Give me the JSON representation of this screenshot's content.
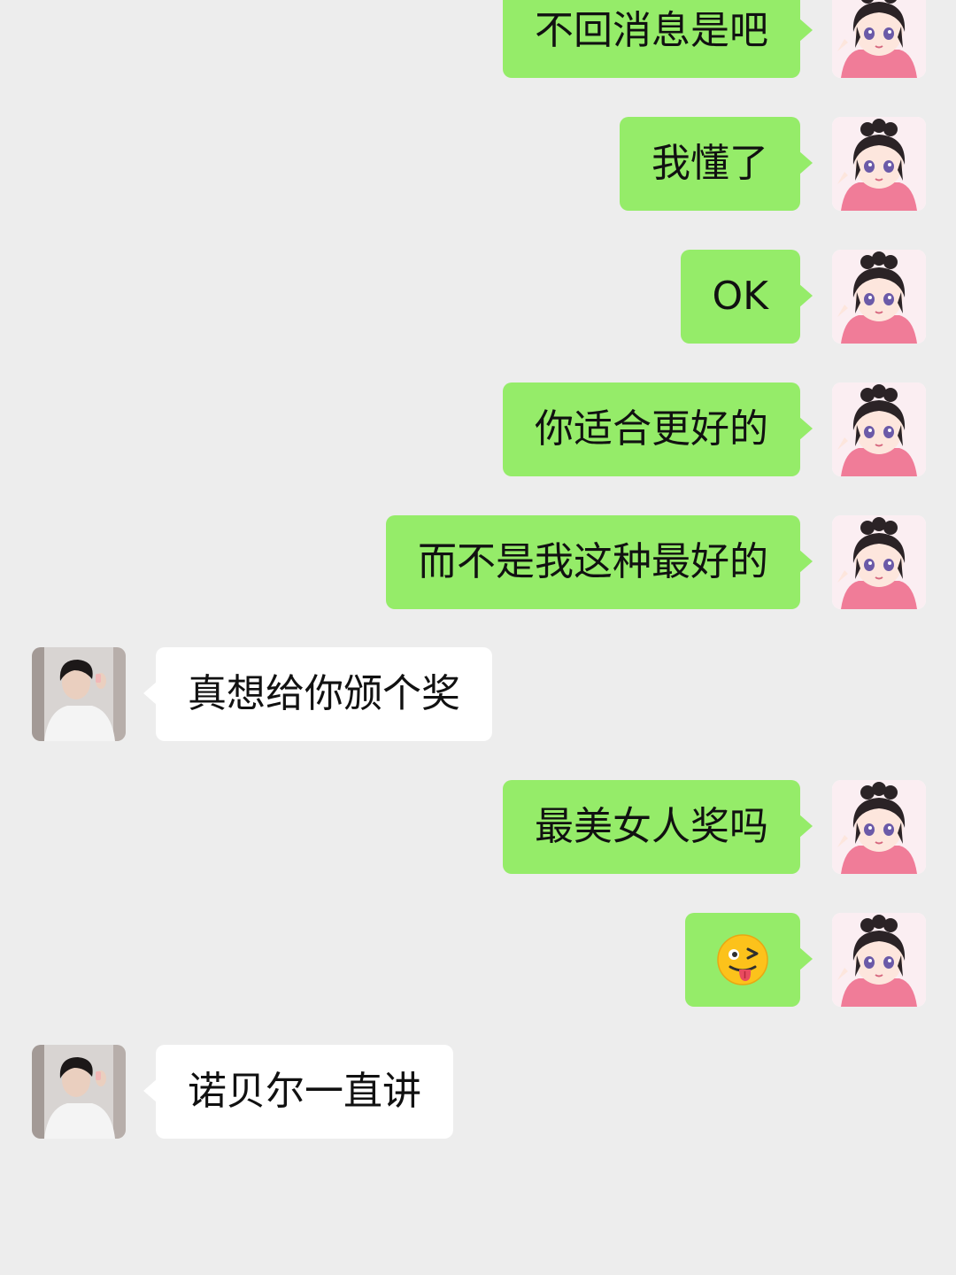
{
  "conversation": {
    "messages": [
      {
        "sender": "me",
        "text": "不回消息是吧"
      },
      {
        "sender": "me",
        "text": "我懂了"
      },
      {
        "sender": "me",
        "text": "OK"
      },
      {
        "sender": "me",
        "text": "你适合更好的"
      },
      {
        "sender": "me",
        "text": "而不是我这种最好的"
      },
      {
        "sender": "other",
        "text": "真想给你颁个奖"
      },
      {
        "sender": "me",
        "text": "最美女人奖吗"
      },
      {
        "sender": "me",
        "text": "",
        "emoji": "winking-face-with-tongue-icon"
      },
      {
        "sender": "other",
        "text": "诺贝尔一直讲"
      }
    ]
  },
  "colors": {
    "background": "#ededed",
    "my_bubble": "#95ec69",
    "their_bubble": "#ffffff",
    "text": "#111111"
  },
  "avatars": {
    "me": "anime-girl-avatar-icon",
    "other": "young-man-photo-avatar-icon"
  }
}
